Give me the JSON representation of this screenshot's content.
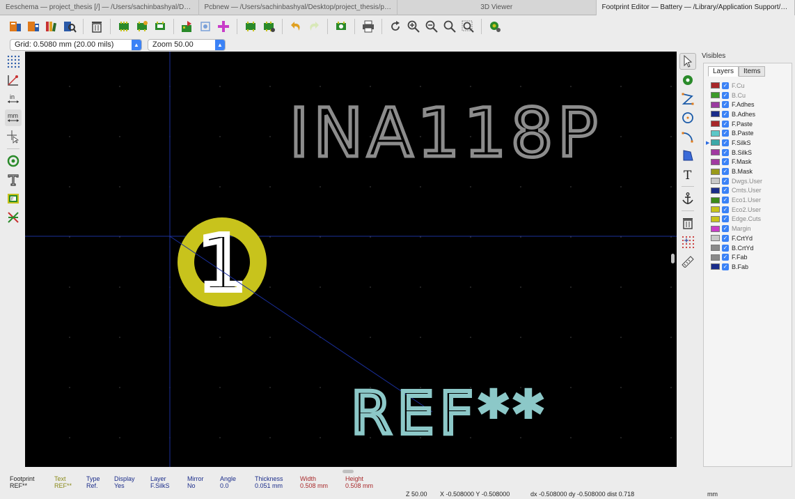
{
  "tabs": [
    {
      "label": "Eeschema — project_thesis [/] — /Users/sachinbashyal/Des...",
      "active": false
    },
    {
      "label": "Pcbnew — /Users/sachinbashyal/Desktop/project_thesis/pro...",
      "active": false
    },
    {
      "label": "3D Viewer",
      "active": false
    },
    {
      "label": "Footprint Editor — Battery — /Library/Application Support/ki...",
      "active": true
    }
  ],
  "toolbar2": {
    "grid_label": "Grid: 0.5080 mm (20.00 mils)",
    "zoom_label": "Zoom 50.00"
  },
  "canvas": {
    "value_text": "INA118P",
    "ref_text": "REF**",
    "pad_number": "1",
    "colors": {
      "background": "#000000",
      "value_text": "#8c8c8c",
      "ref_text": "#8cc8c8",
      "pad": "#c8c31c",
      "crosshair": "#1a2f9c",
      "grid_dot": "#4a4a4a"
    }
  },
  "visibles": {
    "title": "Visibles",
    "tabs": [
      "Layers",
      "Items"
    ],
    "active_layer": "F.SilkS",
    "layers": [
      {
        "name": "F.Cu",
        "color": "#a8282a",
        "dim": true
      },
      {
        "name": "B.Cu",
        "color": "#3c9a2a",
        "dim": true
      },
      {
        "name": "F.Adhes",
        "color": "#9a3aa0",
        "dim": false
      },
      {
        "name": "B.Adhes",
        "color": "#1a2c8a",
        "dim": false
      },
      {
        "name": "F.Paste",
        "color": "#a8282a",
        "dim": false
      },
      {
        "name": "B.Paste",
        "color": "#5cc8c8",
        "dim": false
      },
      {
        "name": "F.SilkS",
        "color": "#3ca8a8",
        "dim": false
      },
      {
        "name": "B.SilkS",
        "color": "#a03aa0",
        "dim": false
      },
      {
        "name": "F.Mask",
        "color": "#a03aa0",
        "dim": false
      },
      {
        "name": "B.Mask",
        "color": "#9a9a1a",
        "dim": false
      },
      {
        "name": "Dwgs.User",
        "color": "#c8c8c8",
        "dim": true
      },
      {
        "name": "Cmts.User",
        "color": "#1a2c8a",
        "dim": true
      },
      {
        "name": "Eco1.User",
        "color": "#3c8a1a",
        "dim": true
      },
      {
        "name": "Eco2.User",
        "color": "#c8c31c",
        "dim": true
      },
      {
        "name": "Edge.Cuts",
        "color": "#c8c31c",
        "dim": true
      },
      {
        "name": "Margin",
        "color": "#c83cc8",
        "dim": true
      },
      {
        "name": "F.CrtYd",
        "color": "#c8c8c8",
        "dim": false
      },
      {
        "name": "B.CrtYd",
        "color": "#8a8a8a",
        "dim": false
      },
      {
        "name": "F.Fab",
        "color": "#8a8a8a",
        "dim": false
      },
      {
        "name": "B.Fab",
        "color": "#1a2c8a",
        "dim": false
      }
    ]
  },
  "msgpanel": [
    {
      "header": "Footprint",
      "value": "REF**",
      "color": "#222222"
    },
    {
      "header": "Text",
      "value": "REF**",
      "color": "#8a8a1a"
    },
    {
      "header": "Type",
      "value": "Ref.",
      "color": "#1a2c8a"
    },
    {
      "header": "Display",
      "value": "Yes",
      "color": "#1a2c8a"
    },
    {
      "header": "Layer",
      "value": "F.SilkS",
      "color": "#1a2c8a"
    },
    {
      "header": "Mirror",
      "value": "No",
      "color": "#1a2c8a"
    },
    {
      "header": "Angle",
      "value": "0.0",
      "color": "#1a2c8a"
    },
    {
      "header": "Thickness",
      "value": "0.051 mm",
      "color": "#1a2c8a"
    },
    {
      "header": "Width",
      "value": "0.508 mm",
      "color": "#a8282a"
    },
    {
      "header": "Height",
      "value": "0.508 mm",
      "color": "#a8282a"
    }
  ],
  "status": {
    "zoom": "Z 50.00",
    "xy": "X -0.508000  Y -0.508000",
    "delta": "dx -0.508000  dy -0.508000  dist 0.718",
    "units": "mm"
  }
}
